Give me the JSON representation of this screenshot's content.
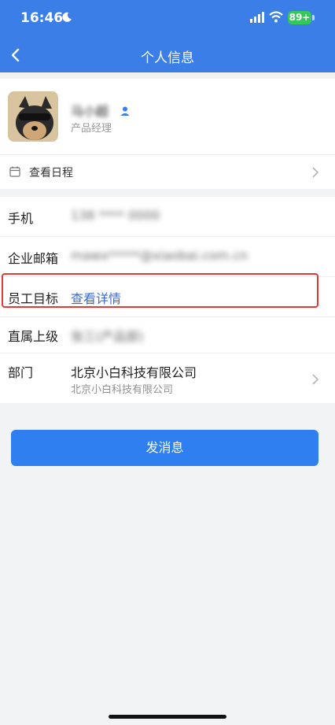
{
  "status_bar": {
    "time": "16:46",
    "battery": "89+"
  },
  "nav": {
    "title": "个人信息"
  },
  "profile": {
    "name": "马小超",
    "title": "产品经理",
    "schedule_label": "查看日程"
  },
  "info": {
    "phone_label": "手机",
    "phone_value": "138 **** 0000",
    "email_label": "企业邮箱",
    "email_value": "mawx*****@xiaobai.com.cn",
    "goal_label": "员工目标",
    "goal_value": "查看详情",
    "manager_label": "直属上级",
    "manager_value": "张三(产品部)",
    "dept_label": "部门",
    "dept_value": "北京小白科技有限公司",
    "dept_sub": "北京小白科技有限公司"
  },
  "actions": {
    "send_message": "发消息"
  },
  "colors": {
    "primary": "#3b7ee8",
    "button": "#2f7ff0",
    "highlight": "#e53935",
    "link": "#3b6cc9"
  }
}
